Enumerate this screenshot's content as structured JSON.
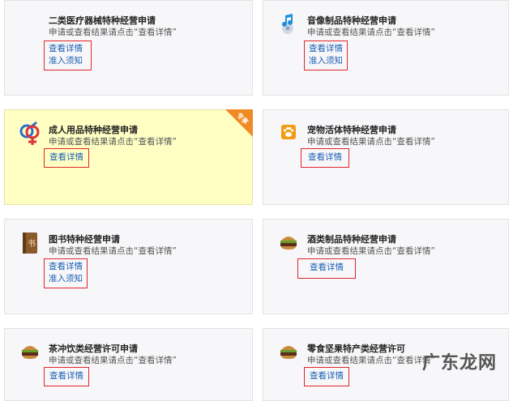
{
  "cards": [
    {
      "title": "二类医疗器械特种经营申请",
      "desc": "申请或查看结果请点击“查看详情”",
      "link1": "查看详情",
      "link2": "准入须知",
      "icon": "medical-device-icon"
    },
    {
      "title": "音像制品特种经营申请",
      "desc": "申请或查看结果请点击“查看详情”",
      "link1": "查看详情",
      "link2": "准入须知",
      "icon": "music-note-icon"
    },
    {
      "title": "成人用品特种经营申请",
      "desc": "申请或查看结果请点击“查看详情”",
      "link1": "查看详情",
      "badge": "专享",
      "icon": "gender-symbol-icon"
    },
    {
      "title": "宠物活体特种经营申请",
      "desc": "申请或查看结果请点击“查看详情”",
      "link1": "查看详情",
      "icon": "paw-icon"
    },
    {
      "title": "图书特种经营申请",
      "desc": "申请或查看结果请点击“查看详情”",
      "link1": "查看详情",
      "link2": "准入须知",
      "icon": "book-icon",
      "icon_text": "书"
    },
    {
      "title": "酒类制品特种经营申请",
      "desc": "申请或查看结果请点击“查看详情”",
      "link1": "查看详情",
      "icon": "burger-icon"
    },
    {
      "title": "茶冲饮类经营许可申请",
      "desc": "申请或查看结果请点击“查看详情”",
      "link1": "查看详情",
      "icon": "burger-icon"
    },
    {
      "title": "零食坚果特产类经营许可",
      "desc": "申请或查看结果请点击“查看详情”",
      "link1": "查看详情",
      "icon": "burger-icon"
    }
  ],
  "watermark": "广东龙网"
}
